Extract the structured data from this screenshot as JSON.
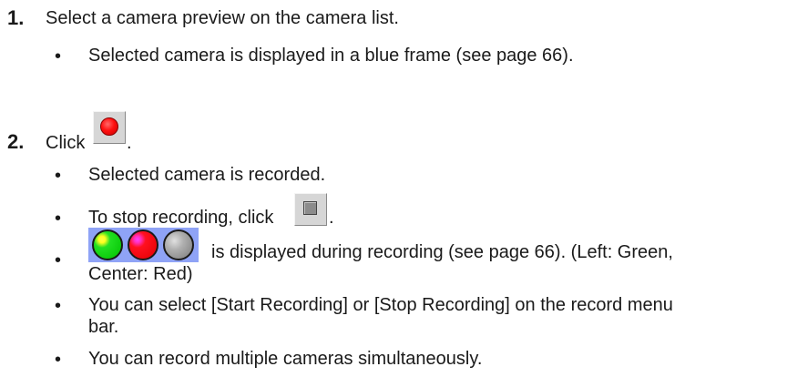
{
  "steps": [
    {
      "number": "1.",
      "text": "Select a camera preview on the camera list.",
      "bullets": [
        "Selected camera is displayed in a blue frame (see page 66)."
      ]
    },
    {
      "number": "2.",
      "text_before": "Click",
      "text_after": ".",
      "button_icon": "record-red-circle-icon",
      "bullets": [
        "Selected camera is recorded.",
        {
          "before": "To stop recording, click",
          "after": ".",
          "icon": "stop-square-icon"
        },
        {
          "after_line1": "is displayed during recording (see page 66). (Left: Green,",
          "line2": "Center: Red)",
          "icon": "recording-status-lamps"
        },
        {
          "line1": "You can select [Start Recording] or [Stop Recording] on the record menu",
          "line2": "bar."
        },
        "You can record multiple cameras simultaneously."
      ]
    }
  ],
  "bullet_char": "•",
  "colors": {
    "status_bar_bg": "#8fa3f6",
    "lamp_left": "green",
    "lamp_center": "red",
    "lamp_right": "gray",
    "record_dot": "#ff1010"
  }
}
